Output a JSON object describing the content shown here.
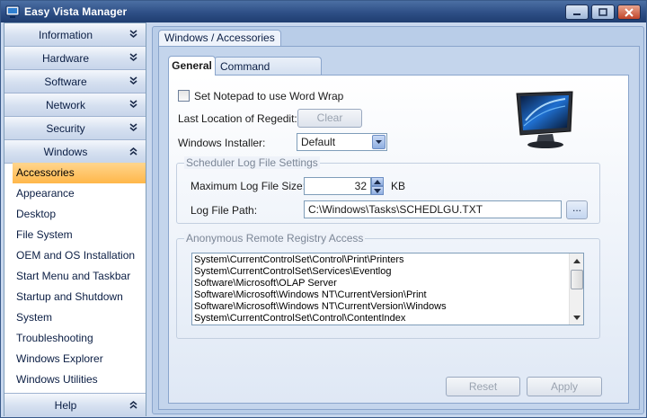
{
  "window": {
    "title": "Easy Vista Manager"
  },
  "sidebar": {
    "categories": [
      {
        "label": "Information",
        "chevron": "chevron-double-down-icon"
      },
      {
        "label": "Hardware",
        "chevron": "chevron-double-down-icon"
      },
      {
        "label": "Software",
        "chevron": "chevron-double-down-icon"
      },
      {
        "label": "Network",
        "chevron": "chevron-double-down-icon"
      },
      {
        "label": "Security",
        "chevron": "chevron-double-down-icon"
      },
      {
        "label": "Windows",
        "chevron": "chevron-double-up-icon"
      }
    ],
    "items": [
      "Accessories",
      "Appearance",
      "Desktop",
      "File System",
      "OEM and OS Installation",
      "Start Menu and Taskbar",
      "Startup and Shutdown",
      "System",
      "Troubleshooting",
      "Windows Explorer",
      "Windows Utilities"
    ],
    "selected_item": "Accessories",
    "help": {
      "label": "Help",
      "chevron": "chevron-double-up-icon"
    }
  },
  "main": {
    "group_title": "Windows / Accessories",
    "tabs": [
      {
        "label": "General",
        "active": true
      },
      {
        "label": "Command Processor",
        "active": false
      }
    ],
    "notepad_wrap": {
      "label": "Set Notepad to use Word Wrap",
      "checked": false
    },
    "regedit": {
      "label": "Last Location of Regedit:",
      "button": "Clear"
    },
    "installer": {
      "label": "Windows Installer:",
      "value": "Default"
    },
    "scheduler": {
      "legend": "Scheduler Log File Settings",
      "max_size_label": "Maximum Log File Size:",
      "max_size_value": "32",
      "max_size_unit": "KB",
      "path_label": "Log File Path:",
      "path_value": "C:\\Windows\\Tasks\\SCHEDLGU.TXT",
      "browse_button": "..."
    },
    "remote_registry": {
      "legend": "Anonymous Remote Registry Access",
      "entries": [
        "System\\CurrentControlSet\\Control\\Print\\Printers",
        "System\\CurrentControlSet\\Services\\Eventlog",
        "Software\\Microsoft\\OLAP Server",
        "Software\\Microsoft\\Windows NT\\CurrentVersion\\Print",
        "Software\\Microsoft\\Windows NT\\CurrentVersion\\Windows",
        "System\\CurrentControlSet\\Control\\ContentIndex"
      ]
    },
    "reset_button": "Reset",
    "apply_button": "Apply"
  },
  "colors": {
    "selected_item": "#ffb74a",
    "title_bar": "#2e4f86",
    "panel": "#c4d5ec"
  }
}
